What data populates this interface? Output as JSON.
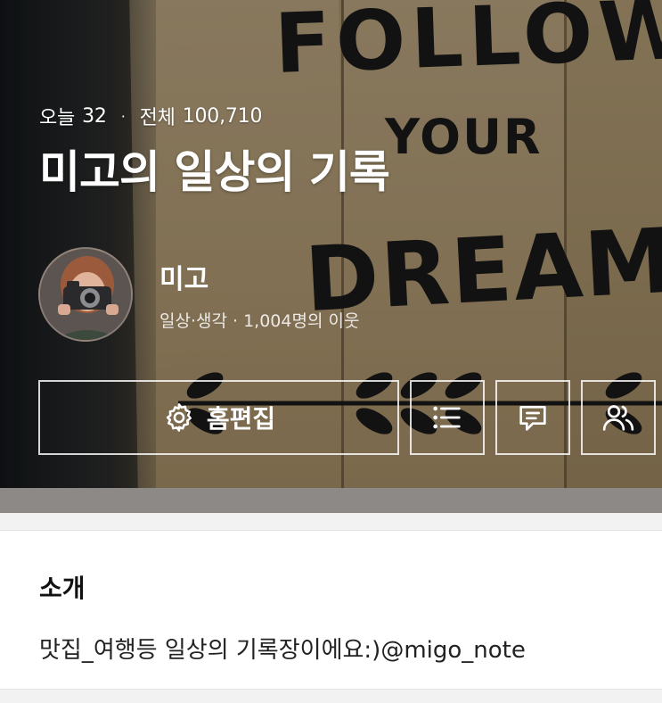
{
  "cover": {
    "poster_line1": "FOLLOW",
    "poster_line2": "YOUR",
    "poster_line3": "DREAMS"
  },
  "stats": {
    "today_label": "오늘",
    "today_count": "32",
    "separator": "·",
    "total_label": "전체",
    "total_count": "100,710"
  },
  "blog": {
    "title": "미고의 일상의 기록"
  },
  "profile": {
    "nickname": "미고",
    "info": "일상·생각 · 1,004명의 이웃"
  },
  "actions": {
    "edit_home_label": "홈편집",
    "icons": [
      "gear-icon",
      "list-icon",
      "chat-icon",
      "neighbors-icon"
    ]
  },
  "intro": {
    "heading": "소개",
    "text": "맛집_여행등 일상의 기록장이에요:)@migo_note"
  },
  "colors": {
    "overlay_text": "#ffffff",
    "button_border": "#ffffff",
    "section_gap": "#f2f2f2"
  }
}
